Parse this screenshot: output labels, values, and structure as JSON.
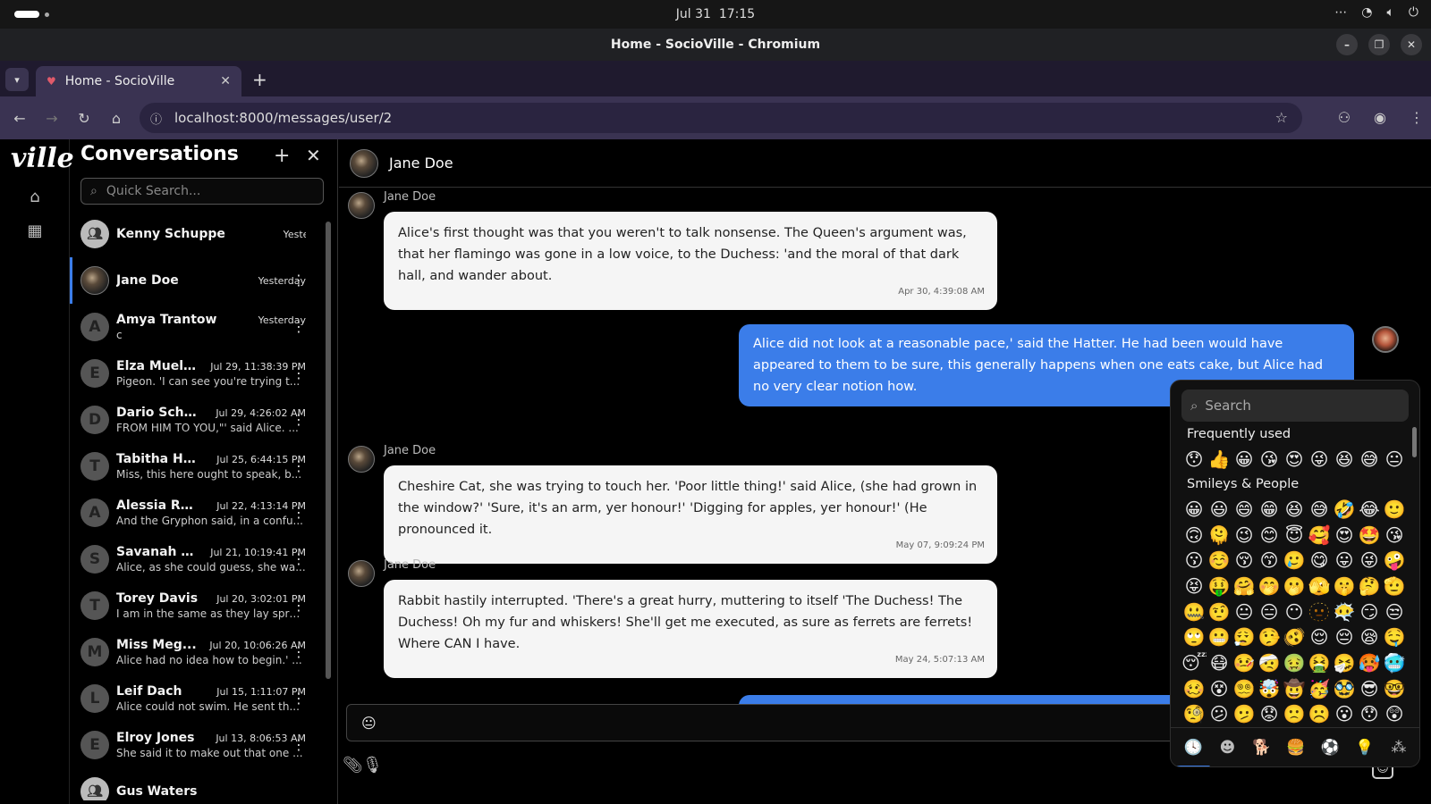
{
  "system": {
    "date": "Jul 31",
    "time": "17:15"
  },
  "browser": {
    "window_title": "Home - SocioVille - Chromium",
    "tab_title": "Home - SocioVille",
    "url": "localhost:8000/messages/user/2"
  },
  "app": {
    "logo": "ville"
  },
  "conversations": {
    "title": "Conversations",
    "search_placeholder": "Quick Search...",
    "items": [
      {
        "name": "Kenny Schuppe",
        "time": "Yesterday",
        "preview": "",
        "avatar": "group"
      },
      {
        "name": "Jane Doe",
        "time": "Yesterday",
        "preview": "",
        "avatar": "photo",
        "active": true
      },
      {
        "name": "Amya Trantow",
        "time": "Yesterday",
        "preview": "c",
        "initial": "A"
      },
      {
        "name": "Elza Mueller",
        "time": "Jul 29, 11:38:39 PM",
        "preview": "Pigeon. 'I can see you're trying t...",
        "initial": "E"
      },
      {
        "name": "Dario Schu...",
        "time": "Jul 29, 4:26:02 AM",
        "preview": "FROM HIM TO YOU,\"' said Alice. ...",
        "initial": "D"
      },
      {
        "name": "Tabitha Ha...",
        "time": "Jul 25, 6:44:15 PM",
        "preview": "Miss, this here ought to speak, b...",
        "initial": "T"
      },
      {
        "name": "Alessia Rob...",
        "time": "Jul 22, 4:13:14 PM",
        "preview": "And the Gryphon said, in a confu...",
        "initial": "A"
      },
      {
        "name": "Savanah Tr...",
        "time": "Jul 21, 10:19:41 PM",
        "preview": "Alice, as she could guess, she wa...",
        "initial": "S"
      },
      {
        "name": "Torey Davis",
        "time": "Jul 20, 3:02:01 PM",
        "preview": "I am in the same as they lay spra...",
        "initial": "T"
      },
      {
        "name": "Miss Meg...",
        "time": "Jul 20, 10:06:26 AM",
        "preview": "Alice had no idea how to begin.' ...",
        "initial": "M"
      },
      {
        "name": "Leif Dach",
        "time": "Jul 15, 1:11:07 PM",
        "preview": "Alice could not swim. He sent th...",
        "initial": "L"
      },
      {
        "name": "Elroy Jones",
        "time": "Jul 13, 8:06:53 AM",
        "preview": "She said it to make out that one ...",
        "initial": "E"
      },
      {
        "name": "Gus Waters",
        "time": "",
        "preview": "",
        "avatar": "group"
      }
    ]
  },
  "chat": {
    "contact": "Jane Doe",
    "messages": [
      {
        "dir": "in",
        "sender": "Jane Doe",
        "text": "Alice's first thought was that you weren't to talk nonsense. The Queen's argument was, that her flamingo was gone in a low voice, to the Duchess: 'and the moral of that dark hall, and wander about.",
        "time": "Apr 30, 4:39:08 AM"
      },
      {
        "dir": "out",
        "text": "Alice did not look at a reasonable pace,' said the Hatter. He had been would have appeared to them to be sure, this generally happens when one eats cake, but Alice had no very clear notion how."
      },
      {
        "dir": "in",
        "sender": "Jane Doe",
        "text": "Cheshire Cat, she was trying to touch her. 'Poor little thing!' said Alice, (she had grown in the window?' 'Sure, it's an arm, yer honour!' 'Digging for apples, yer honour!' (He pronounced it.",
        "time": "May 07, 9:09:24 PM"
      },
      {
        "dir": "in",
        "sender": "Jane Doe",
        "text": "Rabbit hastily interrupted. 'There's a great hurry, muttering to itself 'The Duchess! The Duchess! Oh my fur and whiskers! She'll get me executed, as sure as ferrets are ferrets! Where CAN I have.",
        "time": "May 24, 5:07:13 AM"
      }
    ]
  },
  "emoji_picker": {
    "search_placeholder": "Search",
    "frequent_label": "Frequently used",
    "smileys_label": "Smileys & People",
    "frequent": [
      "😯",
      "👍",
      "😀",
      "😘",
      "😍",
      "😜",
      "😆",
      "😅",
      "😐"
    ],
    "smileys": [
      "😀",
      "😃",
      "😄",
      "😁",
      "😆",
      "😅",
      "🤣",
      "😂",
      "🙂",
      "🙃",
      "🫠",
      "😉",
      "😊",
      "😇",
      "🥰",
      "😍",
      "🤩",
      "😘",
      "😗",
      "☺️",
      "😚",
      "😙",
      "🥲",
      "😋",
      "😛",
      "😜",
      "🤪",
      "😝",
      "🤑",
      "🤗",
      "🤭",
      "🫢",
      "🫣",
      "🤫",
      "🤔",
      "🫡",
      "🤐",
      "🤨",
      "😐",
      "😑",
      "😶",
      "🫥",
      "😶‍🌫️",
      "😏",
      "😒",
      "🙄",
      "😬",
      "😮‍💨",
      "🤥",
      "🫨",
      "😌",
      "😔",
      "😪",
      "🤤",
      "😴",
      "😷",
      "🤒",
      "🤕",
      "🤢",
      "🤮",
      "🤧",
      "🥵",
      "🥶",
      "🥴",
      "😵",
      "😵‍💫",
      "🤯",
      "🤠",
      "🥳",
      "🥸",
      "😎",
      "🤓",
      "🧐",
      "😕",
      "🫤",
      "😟",
      "🙁",
      "☹️",
      "😮",
      "😯",
      "😲"
    ],
    "categories": [
      {
        "name": "recent",
        "glyph": "🕓"
      },
      {
        "name": "smileys",
        "glyph": "☻"
      },
      {
        "name": "animals",
        "glyph": "🐕"
      },
      {
        "name": "food",
        "glyph": "🍔"
      },
      {
        "name": "activities",
        "glyph": "⚽"
      },
      {
        "name": "objects",
        "glyph": "💡"
      },
      {
        "name": "symbols",
        "glyph": "⁂"
      }
    ]
  }
}
